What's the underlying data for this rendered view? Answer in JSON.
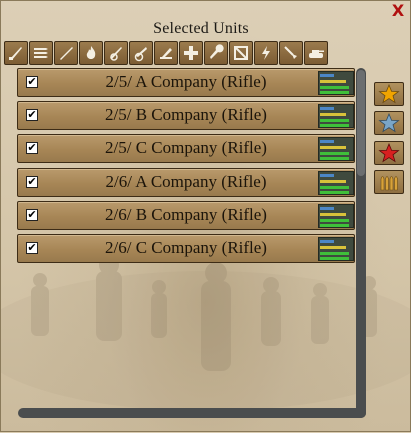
{
  "window": {
    "title": "Selected Units",
    "close_glyph": "X"
  },
  "filter_buttons": [
    {
      "icon": "infantry-rifle-icon"
    },
    {
      "icon": "ammo-icon"
    },
    {
      "icon": "sniper-rifle-icon"
    },
    {
      "icon": "flamethrower-icon"
    },
    {
      "icon": "anti-tank-gun-icon"
    },
    {
      "icon": "artillery-icon"
    },
    {
      "icon": "mortar-icon"
    },
    {
      "icon": "medic-cross-icon"
    },
    {
      "icon": "engineer-wrench-icon"
    },
    {
      "icon": "map-frame-icon"
    },
    {
      "icon": "lightning-bolt-icon"
    },
    {
      "icon": "shovel-icon"
    },
    {
      "icon": "tank-icon"
    }
  ],
  "units": [
    {
      "name": "2/5/ A Company (Rifle)",
      "checked": true,
      "check_glyph": "✔"
    },
    {
      "name": "2/5/ B Company (Rifle)",
      "checked": true,
      "check_glyph": "✔"
    },
    {
      "name": "2/5/ C Company (Rifle)",
      "checked": true,
      "check_glyph": "✔"
    },
    {
      "name": "2/6/ A Company (Rifle)",
      "checked": true,
      "check_glyph": "✔"
    },
    {
      "name": "2/6/ B Company (Rifle)",
      "checked": true,
      "check_glyph": "✔"
    },
    {
      "name": "2/6/ C Company (Rifle)",
      "checked": true,
      "check_glyph": "✔"
    }
  ],
  "status_bar_colors": {
    "blue": "#4b86c6",
    "yellow": "#d8c23a",
    "green": "#3fbf3a"
  },
  "status_bar_levels": [
    0.45,
    0.8,
    0.9,
    0.9
  ],
  "side_buttons": [
    {
      "icon": "gold-star-icon",
      "color": "#f0a400"
    },
    {
      "icon": "silver-star-icon",
      "color": "#7aa6c8"
    },
    {
      "icon": "red-star-icon",
      "color": "#d82020"
    },
    {
      "icon": "ammunition-rounds-icon",
      "color": "#d8a23a"
    }
  ]
}
